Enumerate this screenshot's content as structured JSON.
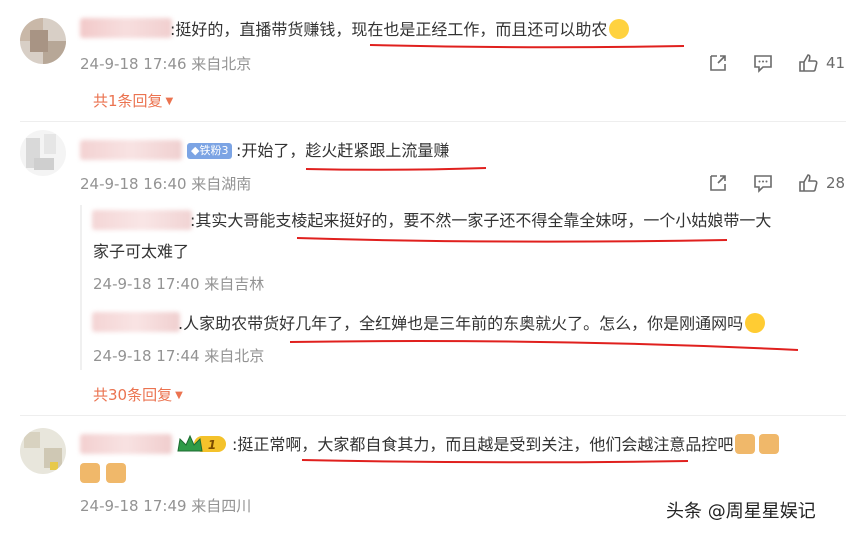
{
  "comments": [
    {
      "text": ":挺好的，直播带货赚钱，现在也是正经工作，而且还可以助农",
      "meta": "24-9-18 17:46 来自北京",
      "likes": "41",
      "replies_link": "共1条回复"
    },
    {
      "badge": "铁粉3",
      "text": ":开始了，趁火赶紧跟上流量赚",
      "meta": "24-9-18 16:40 来自湖南",
      "likes": "28",
      "replies": [
        {
          "text_line1": ":其实大哥能支棱起来挺好的，要不然一家子还不得全靠全妹呀，一个小姑娘带一大",
          "text_line2": "家子可太难了",
          "meta": "24-9-18 17:40 来自吉林"
        },
        {
          "text": ".人家助农带货好几年了，全红婵也是三年前的东奥就火了。怎么，你是刚通网吗",
          "meta": "24-9-18 17:44 来自北京"
        }
      ],
      "replies_link": "共30条回复"
    },
    {
      "badge_vip": "1",
      "text": ":挺正常啊，大家都自食其力，而且越是受到关注，他们会越注意品控吧",
      "meta": "24-9-18 17:49 来自四川"
    }
  ],
  "watermark": "头条 @周星星娱记",
  "colors": {
    "link": "#eb7350",
    "meta": "#939393",
    "underline": "#e0201e",
    "fans_badge": "#7ca4e4"
  },
  "icons": [
    "share-icon",
    "comment-icon",
    "like-icon"
  ]
}
